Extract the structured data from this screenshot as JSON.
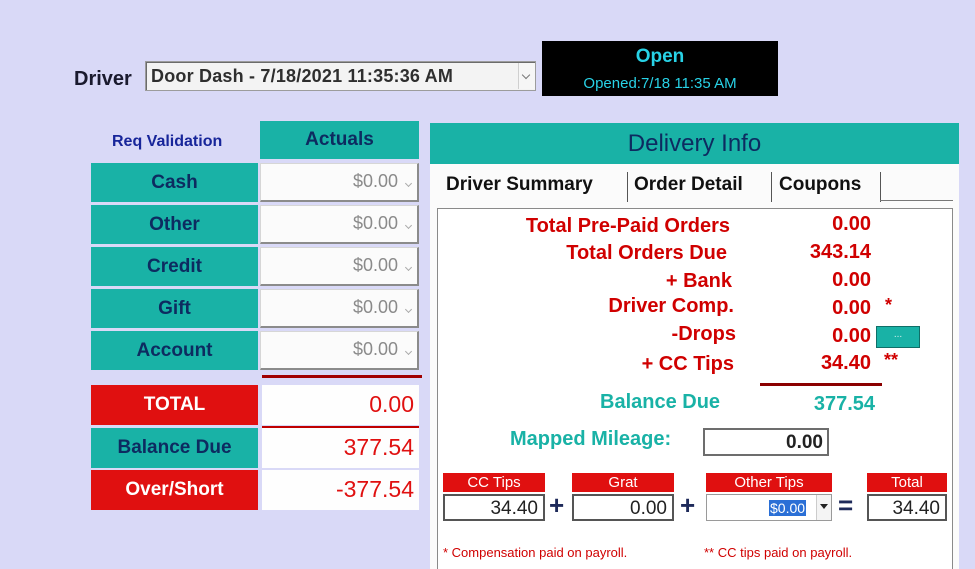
{
  "driver": {
    "label": "Driver",
    "selected": "Door Dash - 7/18/2021 11:35:36 AM"
  },
  "status": {
    "title": "Open",
    "opened": "Opened:7/18 11:35 AM"
  },
  "payments": {
    "req_validation": "Req Validation",
    "actuals_header": "Actuals",
    "rows": [
      {
        "label": "Cash",
        "value": "$0.00"
      },
      {
        "label": "Other",
        "value": "$0.00"
      },
      {
        "label": "Credit",
        "value": "$0.00"
      },
      {
        "label": "Gift",
        "value": "$0.00"
      },
      {
        "label": "Account",
        "value": "$0.00"
      }
    ],
    "total_label": "TOTAL",
    "total_value": "0.00",
    "balance_due_label": "Balance Due",
    "balance_due_value": "377.54",
    "over_short_label": "Over/Short",
    "over_short_value": "-377.54"
  },
  "delivery_info": {
    "title": "Delivery Info",
    "tabs": [
      "Driver Summary",
      "Order Detail",
      "Coupons"
    ],
    "summary": {
      "total_prepaid_label": "Total Pre-Paid Orders",
      "total_prepaid_value": "0.00",
      "total_orders_due_label": "Total Orders Due",
      "total_orders_due_value": "343.14",
      "bank_label": "+ Bank",
      "bank_value": "0.00",
      "driver_comp_label": "Driver Comp.",
      "driver_comp_value": "0.00",
      "driver_comp_mark": "*",
      "drops_label": "-Drops",
      "drops_value": "0.00",
      "drops_button": "...",
      "cc_tips_label": "+ CC Tips",
      "cc_tips_value": "34.40",
      "cc_tips_mark": "**",
      "balance_due_label": "Balance Due",
      "balance_due_value": "377.54",
      "mapped_mileage_label": "Mapped Mileage:",
      "mapped_mileage_value": "0.00"
    },
    "tips": {
      "cc_tips_label": "CC Tips",
      "cc_tips_value": "34.40",
      "grat_label": "Grat",
      "grat_value": "0.00",
      "other_tips_label": "Other Tips",
      "other_tips_value": "$0.00",
      "total_label": "Total",
      "total_value": "34.40",
      "plus": "+",
      "equals": "="
    },
    "footnotes": {
      "comp": "* Compensation paid on payroll.",
      "cc": "** CC tips paid on payroll."
    }
  },
  "colors": {
    "background": "#d9d9f7",
    "teal": "#19b2a6",
    "red": "#e01010",
    "navy_text": "#0d2b60"
  }
}
